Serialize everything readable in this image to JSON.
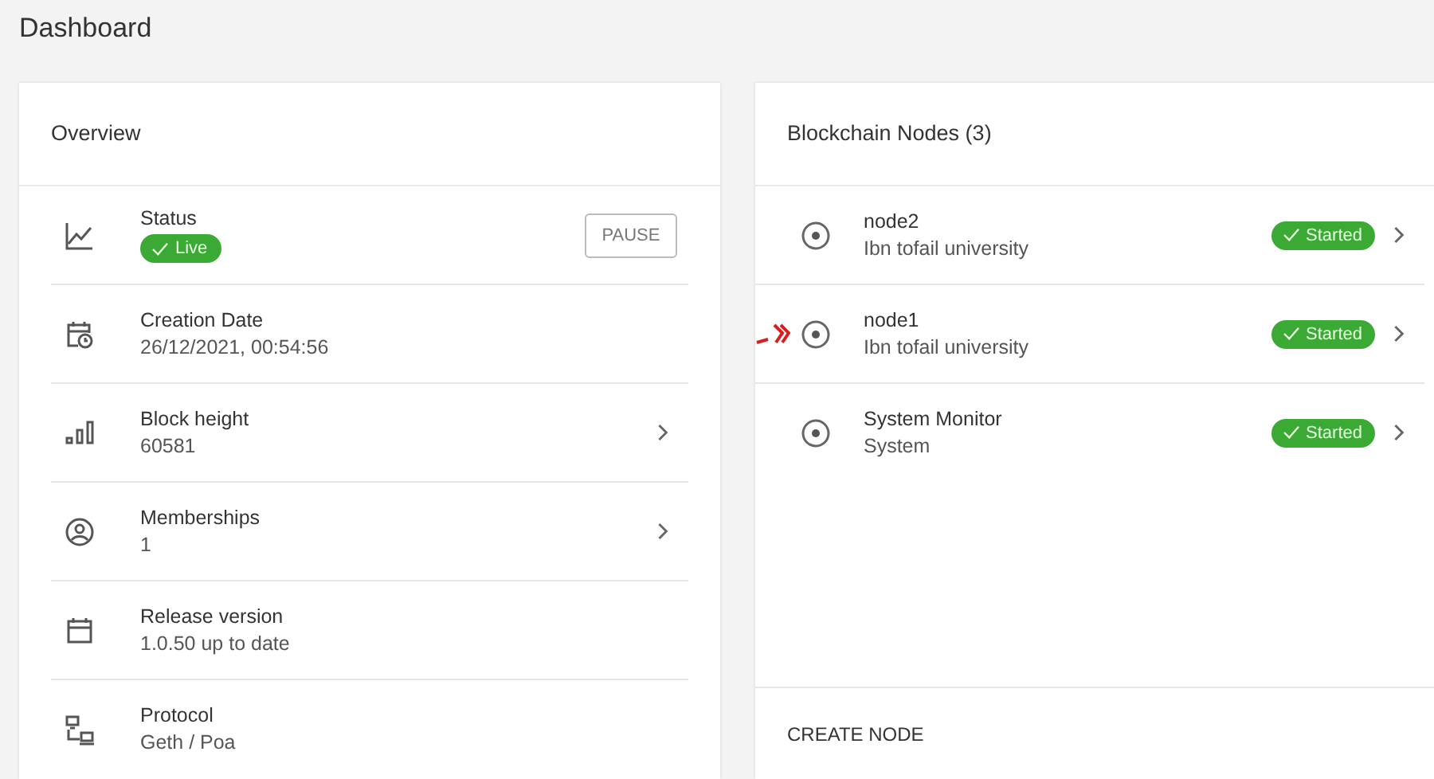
{
  "page_title": "Dashboard",
  "overview": {
    "title": "Overview",
    "rows": [
      {
        "kind": "status",
        "label": "Status",
        "badge": "Live",
        "button": "PAUSE"
      },
      {
        "kind": "plain",
        "label": "Creation Date",
        "value": "26/12/2021, 00:54:56"
      },
      {
        "kind": "link",
        "label": "Block height",
        "value": "60581"
      },
      {
        "kind": "link",
        "label": "Memberships",
        "value": "1"
      },
      {
        "kind": "plain",
        "label": "Release version",
        "value": "1.0.50 up to date"
      },
      {
        "kind": "plain",
        "label": "Protocol",
        "value": "Geth / Poa"
      }
    ]
  },
  "nodes": {
    "title": "Blockchain Nodes (3)",
    "items": [
      {
        "name": "node2",
        "org": "Ibn tofail university",
        "status": "Started",
        "marked": false
      },
      {
        "name": "node1",
        "org": "Ibn tofail university",
        "status": "Started",
        "marked": true
      },
      {
        "name": "System Monitor",
        "org": "System",
        "status": "Started",
        "marked": false
      }
    ],
    "action": "CREATE NODE"
  }
}
